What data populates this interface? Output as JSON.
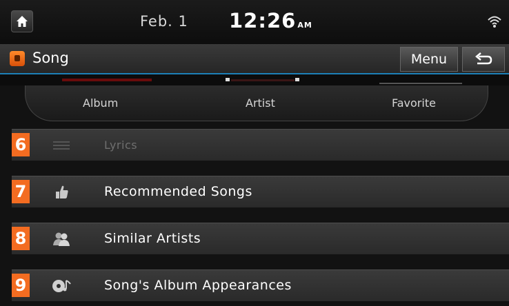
{
  "statusbar": {
    "date": "Feb.  1",
    "time": "12:26",
    "ampm": "AM"
  },
  "titlebar": {
    "title": "Song",
    "menu_label": "Menu"
  },
  "tabs": [
    {
      "label": "Album"
    },
    {
      "label": "Artist"
    },
    {
      "label": "Favorite"
    }
  ],
  "menu_items": [
    {
      "number": "6",
      "label": "Lyrics",
      "icon": "lyrics-icon",
      "enabled": false
    },
    {
      "number": "7",
      "label": "Recommended Songs",
      "icon": "thumbs-up-icon",
      "enabled": true
    },
    {
      "number": "8",
      "label": "Similar Artists",
      "icon": "people-icon",
      "enabled": true
    },
    {
      "number": "9",
      "label": "Song's Album Appearances",
      "icon": "album-icon",
      "enabled": true
    }
  ],
  "colors": {
    "accent": "#1c80b8",
    "badge": "#f36c21",
    "song_icon": "#ff8a2a"
  }
}
